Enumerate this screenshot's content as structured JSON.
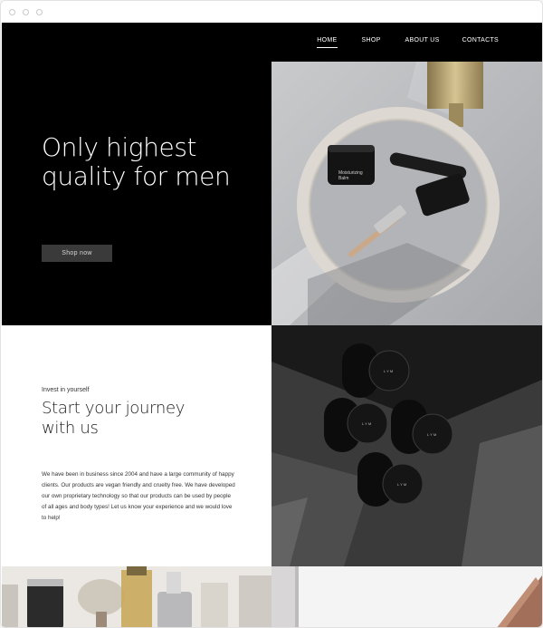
{
  "nav": {
    "items": [
      {
        "label": "HOME",
        "active": true
      },
      {
        "label": "SHOP",
        "active": false
      },
      {
        "label": "ABOUT US",
        "active": false
      },
      {
        "label": "CONTACTS",
        "active": false
      }
    ]
  },
  "hero": {
    "title_line1": "Only highest",
    "title_line2": "quality for men",
    "cta_label": "Shop now"
  },
  "journey": {
    "eyebrow": "Invest in yourself",
    "title_line1": "Start your journey",
    "title_line2": "with us",
    "body": "We have been in business since 2004 and have a large community of happy clients. Our products are vegan friendly and cruelty free. We have developed our own proprietary technology so that our products can be used by people of all ages and body types! Let us know your experience and we would love to help!"
  },
  "products": {
    "jar_label": "Moisturizing Balm",
    "brand": "L Y M"
  },
  "colors": {
    "nav_bg": "#000000",
    "hero_bg": "#000000",
    "button_bg": "#3a3a3a",
    "text_dark": "#1a1a1a"
  }
}
